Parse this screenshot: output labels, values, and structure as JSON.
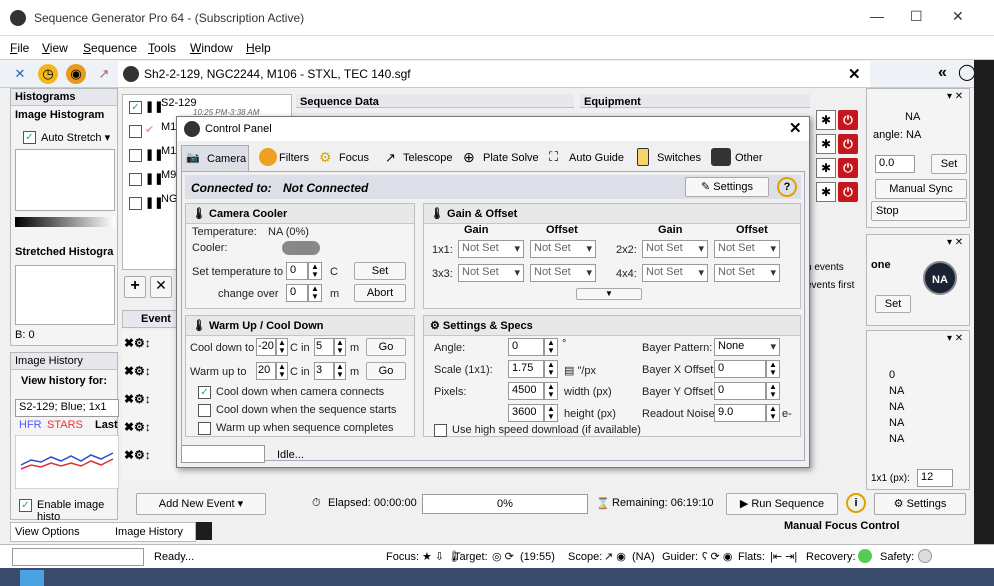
{
  "window": {
    "title": "Sequence Generator Pro 64 - (Subscription Active)"
  },
  "menu": [
    "File",
    "View",
    "Sequence",
    "Tools",
    "Window",
    "Help"
  ],
  "doc_tab": {
    "title": "Sh2-2-129, NGC2244, M106 - STXL, TEC 140.sgf"
  },
  "histograms": {
    "title": "Histograms",
    "image_histogram": "Image Histogram",
    "auto_stretch": "Auto Stretch ▾",
    "stretched": "Stretched Histogra",
    "b_value": "B: 0"
  },
  "image_history": {
    "title": "Image History",
    "view_for": "View history for:",
    "selected": "S2-129; Blue; 1x1",
    "hfr": "HFR",
    "stars": "STARS",
    "last": "Last",
    "enable": "Enable image histo"
  },
  "tabs_bottom": {
    "view_options": "View Options",
    "image_history": "Image History"
  },
  "targets": {
    "items": [
      "S2-129",
      "M10",
      "M10",
      "M9C",
      "NG"
    ],
    "time": "10:25 PM-3:38 AM"
  },
  "sequence_data": {
    "title": "Sequence Data"
  },
  "equipment": {
    "title": "Equipment"
  },
  "event_label": "Event",
  "add_event": "Add New Event",
  "elapsed": "Elapsed: 00:00:00",
  "progress": "0%",
  "remaining": "Remaining: 06:19:10",
  "run_sequence": "Run Sequence",
  "settings": "Settings",
  "right_panel": {
    "na1": "NA",
    "angle": "angle: NA",
    "val": "0.0",
    "set": "Set",
    "manual_sync": "Manual Sync",
    "stop": "Stop",
    "events": "h events",
    "events_first": "events first",
    "none": "one",
    "na_badge": "NA",
    "set2": "Set",
    "zero": "0",
    "na_list": [
      "NA",
      "NA",
      "NA",
      "NA"
    ],
    "fx": "1x1 (px):",
    "fx_val": "12",
    "mfc": "Manual Focus Control"
  },
  "control_panel": {
    "title": "Control Panel",
    "tabs": [
      "Camera",
      "Filters",
      "Focus",
      "Telescope",
      "Plate Solve",
      "Auto Guide",
      "Switches",
      "Other"
    ],
    "connected_label": "Connected to:",
    "connected_value": "Not Connected",
    "settings": "Settings",
    "cooler": {
      "title": "Camera Cooler",
      "temp_label": "Temperature:",
      "temp_value": "NA (0%)",
      "cooler_label": "Cooler:",
      "set_temp": "Set temperature to",
      "set_temp_val": "0",
      "unit_c": "C",
      "set_btn": "Set",
      "change_over": "change over",
      "change_val": "0",
      "unit_m": "m",
      "abort": "Abort"
    },
    "gain": {
      "title": "Gain & Offset",
      "gain": "Gain",
      "offset": "Offset",
      "rows": [
        "1x1:",
        "3x3:",
        "2x2:",
        "4x4:"
      ],
      "not_set": "Not Set"
    },
    "warm": {
      "title": "Warm Up / Cool Down",
      "cool_label": "Cool down to",
      "cool_temp": "-20",
      "cool_in": "C in",
      "cool_min": "5",
      "warm_label": "Warm up to",
      "warm_temp": "20",
      "warm_min": "3",
      "m": "m",
      "go": "Go",
      "opt1": "Cool down when camera connects",
      "opt2": "Cool down when the sequence starts",
      "opt3": "Warm up when sequence completes"
    },
    "specs": {
      "title": "Settings & Specs",
      "angle": "Angle:",
      "angle_val": "0",
      "deg": "°",
      "scale": "Scale (1x1):",
      "scale_val": "1.75",
      "scale_unit": "\"/px",
      "pixels": "Pixels:",
      "width": "4500",
      "width_unit": "width (px)",
      "height": "3600",
      "height_unit": "height (px)",
      "bayer_pattern": "Bayer Pattern:",
      "bayer_val": "None",
      "bayer_x": "Bayer X Offset:",
      "bx": "0",
      "bayer_y": "Bayer Y Offset:",
      "by": "0",
      "readout": "Readout Noise:",
      "readout_val": "9.0",
      "readout_unit": "e-",
      "high_speed": "Use high speed download (if available)"
    },
    "status": "Idle..."
  },
  "statusbar": {
    "ready": "Ready...",
    "focus": "Focus:",
    "target": "Target:",
    "target_time": "(19:55)",
    "scope": "Scope:",
    "scope_val": "(NA)",
    "guider": "Guider:",
    "flats": "Flats:",
    "recovery": "Recovery:",
    "safety": "Safety:"
  }
}
